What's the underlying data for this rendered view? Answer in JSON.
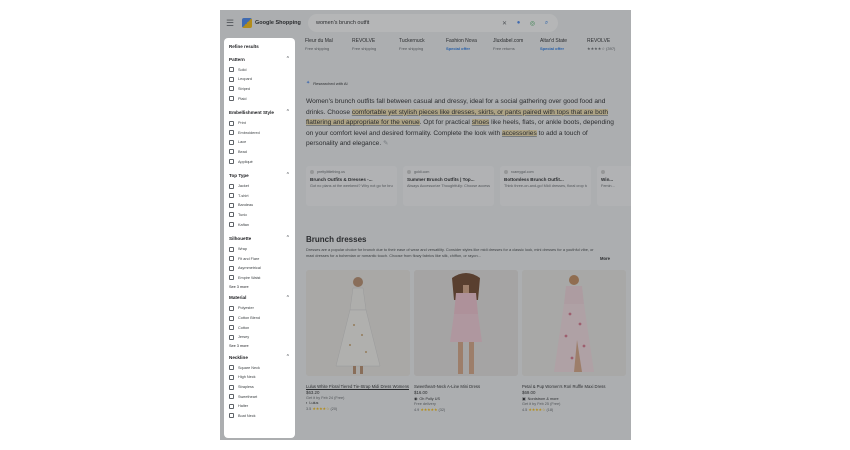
{
  "header": {
    "menu_icon": "hamburger-icon",
    "logo_text": "Google Shopping",
    "search_value": "women's brunch outfit",
    "icons": [
      "close-icon",
      "mic-icon",
      "lens-icon",
      "search-icon"
    ]
  },
  "merchants": [
    {
      "name": "Fleur du Mal",
      "shipping": "Free shipping",
      "special": false
    },
    {
      "name": "REVOLVE",
      "shipping": "Free shipping",
      "special": false
    },
    {
      "name": "Tuckernuck",
      "shipping": "Free shipping",
      "special": false
    },
    {
      "name": "Fashion Nova",
      "shipping": "Special offer",
      "special": true
    },
    {
      "name": "Jluxlabel.com",
      "shipping": "Free returns",
      "special": false
    },
    {
      "name": "Altar'd State",
      "shipping": "Special offer",
      "special": true
    },
    {
      "name": "REVOLVE",
      "shipping": "★★★★☆ (397)",
      "special": false
    }
  ],
  "filters": {
    "title": "Refine results",
    "groups": [
      {
        "name": "Pattern",
        "options": [
          "Solid",
          "Leopard",
          "Striped",
          "Plaid"
        ],
        "see_more": ""
      },
      {
        "name": "Embellishment Style",
        "options": [
          "Print",
          "Embroidered",
          "Lace",
          "Bead",
          "Appliqué"
        ],
        "see_more": ""
      },
      {
        "name": "Top Type",
        "options": [
          "Jacket",
          "T-shirt",
          "Bandeau",
          "Tunic",
          "Kaftan"
        ],
        "see_more": ""
      },
      {
        "name": "Silhouette",
        "options": [
          "Wrap",
          "Fit and Flare",
          "Asymmetrical",
          "Empire Waist"
        ],
        "see_more": "See 3 more"
      },
      {
        "name": "Material",
        "options": [
          "Polyester",
          "Cotton Blend",
          "Cotton",
          "Jersey"
        ],
        "see_more": "See 3 more"
      },
      {
        "name": "Neckline",
        "options": [
          "Square Neck",
          "High Neck",
          "Strapless",
          "Sweetheart",
          "Halter",
          "Boat Neck"
        ],
        "see_more": ""
      }
    ]
  },
  "ai": {
    "badge": "Researched with AI",
    "text_parts": [
      {
        "t": "Women's brunch outfits fall between casual and dressy, ideal for a social gathering over good food and drinks. Choose ",
        "hl": false
      },
      {
        "t": "comfortable yet stylish pieces like dresses, skirts, or pants paired with tops that are both flattering and appropriate for the venue",
        "hl": true
      },
      {
        "t": ". Opt for practical ",
        "hl": false
      },
      {
        "t": "shoes",
        "hl": true
      },
      {
        "t": " like heels, flats, or ankle boots, depending on your comfort level and desired formality. Complete the look with ",
        "hl": false
      },
      {
        "t": "accessories",
        "hl": true
      },
      {
        "t": " to add a touch of personality and elegance.",
        "hl": false
      }
    ],
    "sources": [
      {
        "site": "prettylittlething.us",
        "title": "Brunch Outfits & Dresses -...",
        "snippet": "Got no plans at the weekend? Why not go for brunch with your..."
      },
      {
        "site": "goldi.com",
        "title": "Summer Brunch Outfits | Top...",
        "snippet": "Always Accessorize Thoughtfully: Choose accessories that complement your..."
      },
      {
        "site": "roamygal.com",
        "title": "Bottomless Brunch Outfit...",
        "snippet": "Think three-on-and-go! Midi dresses, floral crop tops, leopard..."
      },
      {
        "site": "",
        "title": "Win...",
        "snippet": "Femin..."
      }
    ]
  },
  "section": {
    "title": "Brunch dresses",
    "description": "Dresses are a popular choice for brunch due to their ease of wear and versatility. Consider styles like midi dresses for a classic look, mini dresses for a youthful vibe, or maxi dresses for a bohemian or romantic touch. Choose from flowy fabrics like silk, chiffon, or rayon...",
    "more_label": "More"
  },
  "products": [
    {
      "name": "Lulus White Floral Tiered Tie-Strap Midi Dress Womens",
      "price": "$63.20",
      "delivery": "Get it by Feb 24 (Free)",
      "seller": "Lulus",
      "rating": "3.5",
      "stars": "★★★★☆",
      "reviews": "(20)"
    },
    {
      "name": "Sweetheart-Neck A-Line Mini Dress",
      "price": "$16.00",
      "delivery": "Free delivery",
      "seller": "Oh Polly US",
      "rating": "4.9",
      "stars": "★★★★★",
      "reviews": "(32)"
    },
    {
      "name": "Petal & Pup Women's Rori Ruffle Maxi Dress",
      "price": "$69.00",
      "delivery": "Get it by Feb 25 (Free)",
      "seller": "Nordstrom & more",
      "rating": "4.5",
      "stars": "★★★★☆",
      "reviews": "(18)"
    }
  ]
}
